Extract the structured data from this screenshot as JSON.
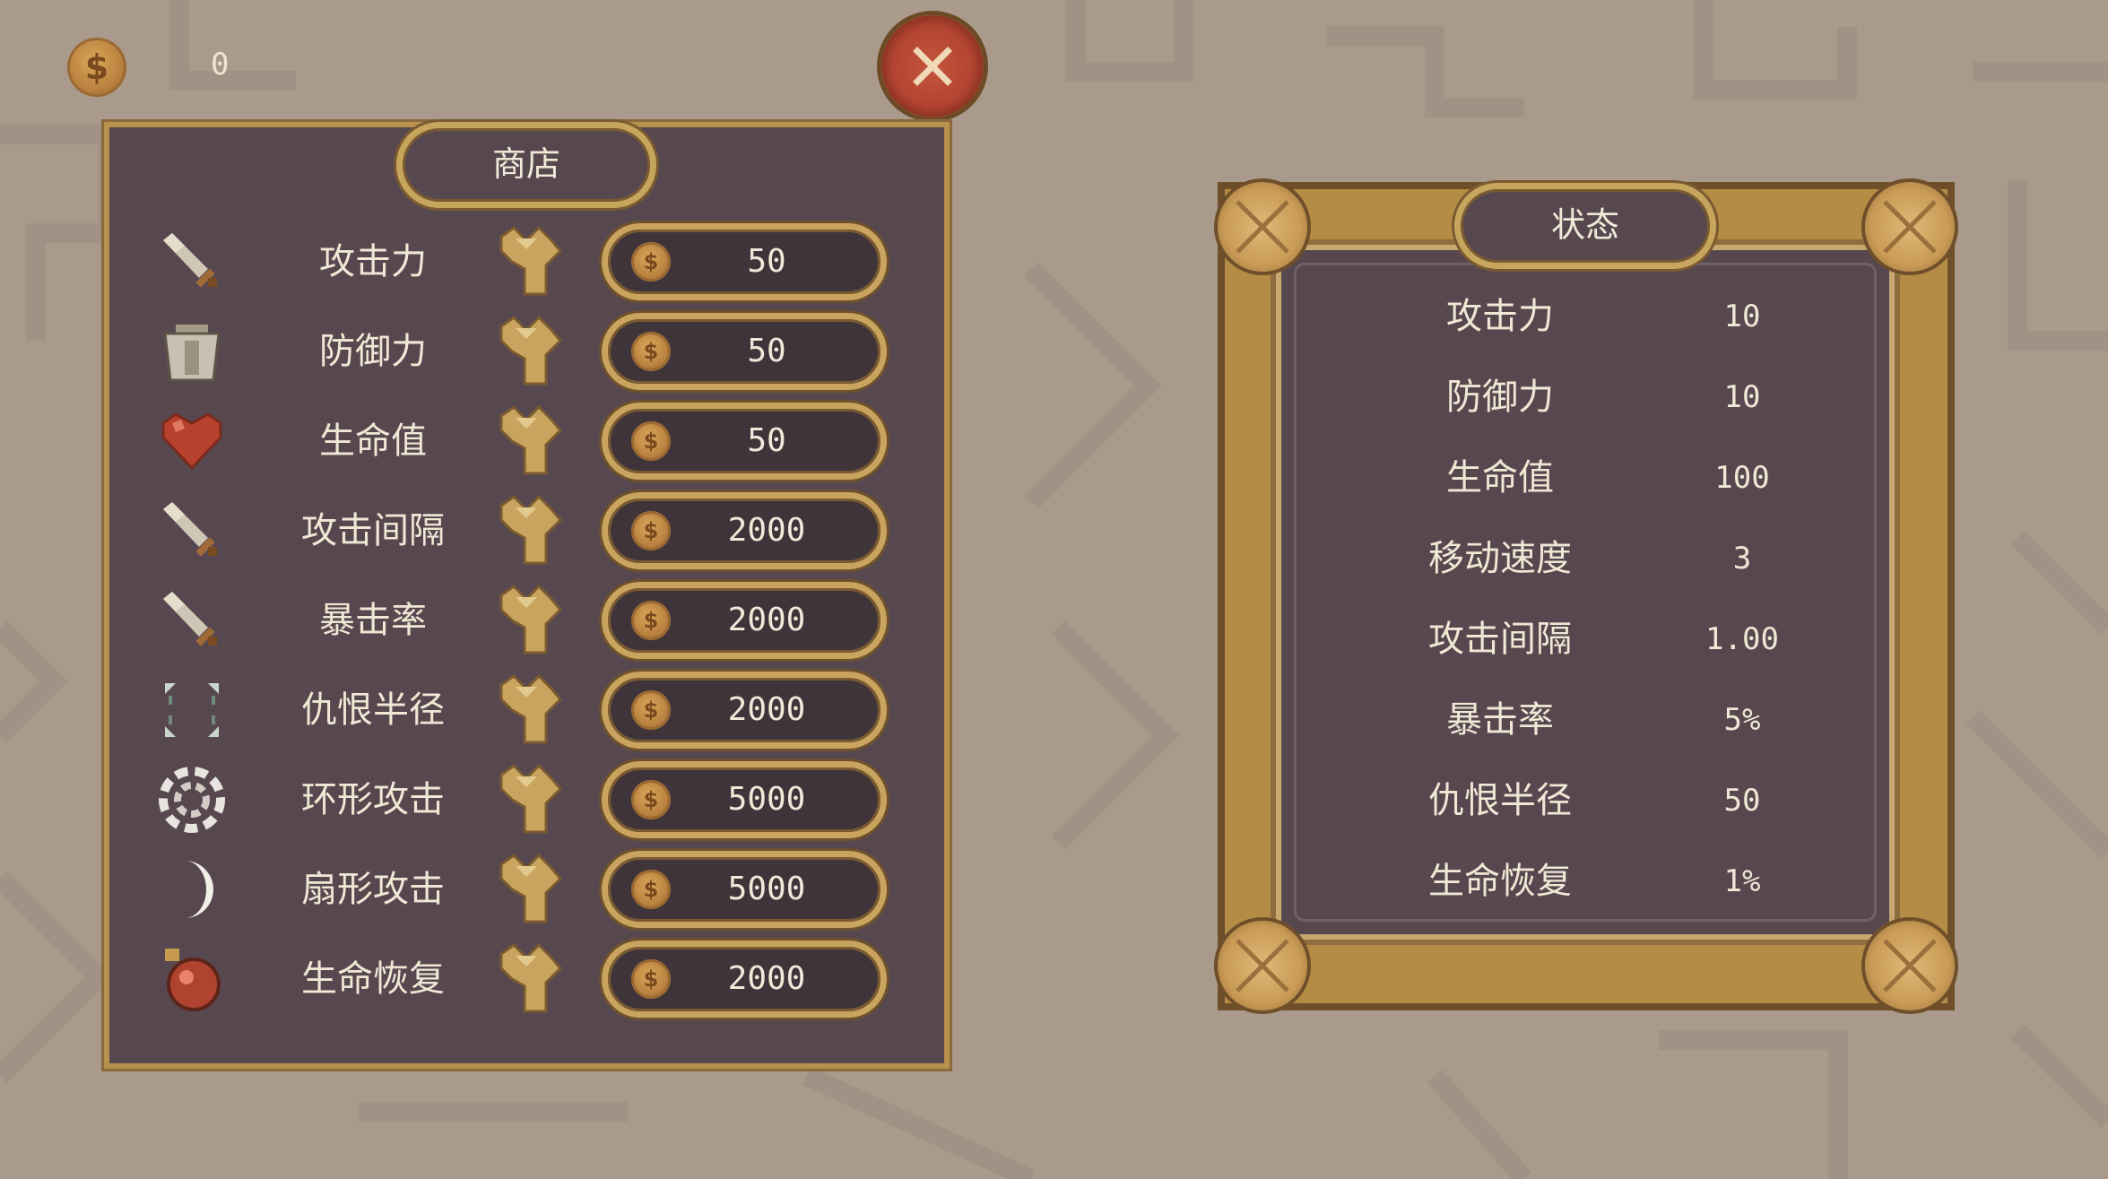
{
  "currency": {
    "amount": "0",
    "icon": "coin-icon"
  },
  "close_button": {
    "icon": "close-icon",
    "color": "#b24431"
  },
  "shop": {
    "title": "商店",
    "items": [
      {
        "label": "攻击力",
        "icon": "sword-icon",
        "price": "50"
      },
      {
        "label": "防御力",
        "icon": "armor-icon",
        "price": "50"
      },
      {
        "label": "生命值",
        "icon": "heart-icon",
        "price": "50"
      },
      {
        "label": "攻击间隔",
        "icon": "sword-icon",
        "price": "2000"
      },
      {
        "label": "暴击率",
        "icon": "sword-icon",
        "price": "2000"
      },
      {
        "label": "仇恨半径",
        "icon": "radius-icon",
        "price": "2000"
      },
      {
        "label": "环形攻击",
        "icon": "spiral-icon",
        "price": "5000"
      },
      {
        "label": "扇形攻击",
        "icon": "crescent-icon",
        "price": "5000"
      },
      {
        "label": "生命恢复",
        "icon": "potion-icon",
        "price": "2000"
      }
    ]
  },
  "status": {
    "title": "状态",
    "stats": [
      {
        "label": "攻击力",
        "value": "10"
      },
      {
        "label": "防御力",
        "value": "10"
      },
      {
        "label": "生命值",
        "value": "100"
      },
      {
        "label": "移动速度",
        "value": "3"
      },
      {
        "label": "攻击间隔",
        "value": "1.00"
      },
      {
        "label": "暴击率",
        "value": "5%"
      },
      {
        "label": "仇恨半径",
        "value": "50"
      },
      {
        "label": "生命恢复",
        "value": "1%"
      }
    ]
  },
  "colors": {
    "background": "#a99a8c",
    "panel": "#57484f",
    "gold": "#c8a55d",
    "text": "#f0e7d5"
  }
}
